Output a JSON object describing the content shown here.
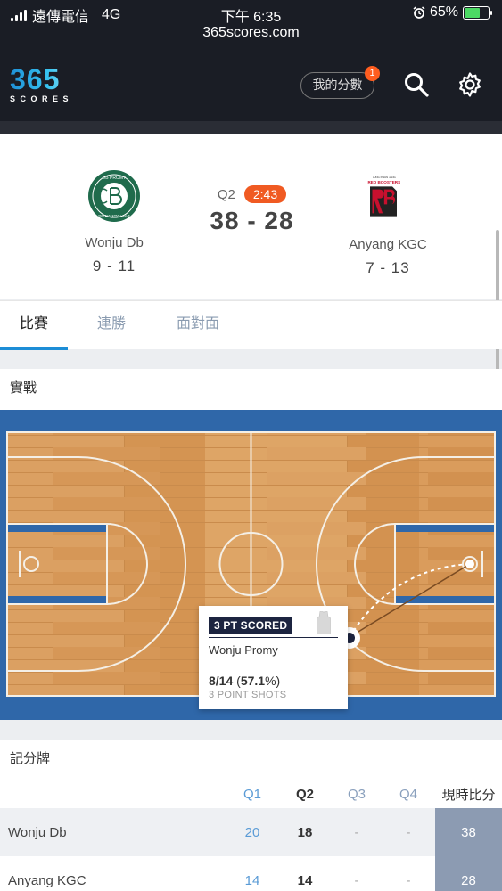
{
  "status_bar": {
    "carrier": "遠傳電信",
    "network": "4G",
    "time": "下午 6:35",
    "url": "365scores.com",
    "battery": "65%",
    "battery_level": 0.65
  },
  "header": {
    "logo_number": "365",
    "logo_text": "SCORES",
    "my_scores_label": "我的分數",
    "notification_count": "1"
  },
  "match": {
    "home": {
      "name": "Wonju Db",
      "record": "9 - 11",
      "logo_text": "DB PROMY",
      "logo_sub": "PRO BASKETBALL CLUB"
    },
    "away": {
      "name": "Anyang KGC",
      "record": "7 - 13",
      "logo_text": "RED BOOSTERS",
      "logo_top": "JUNG KWAN JANG"
    },
    "period": "Q2",
    "clock": "2:43",
    "score": "38 - 28"
  },
  "tabs": [
    {
      "label": "比賽",
      "active": true
    },
    {
      "label": "連勝",
      "active": false
    },
    {
      "label": "面對面",
      "active": false
    }
  ],
  "play": {
    "title": "實戰",
    "event_tag": "3 PT SCORED",
    "player": "Wonju Promy",
    "stat_made": "8/14",
    "stat_pct": "57.1",
    "stat_label": "3 POINT SHOTS"
  },
  "scoreboard": {
    "title": "記分牌",
    "headers": [
      "Q1",
      "Q2",
      "Q3",
      "Q4",
      "現時比分"
    ],
    "rows": [
      {
        "team": "Wonju Db",
        "q1": "20",
        "q2": "18",
        "q3": "-",
        "q4": "-",
        "total": "38"
      },
      {
        "team": "Anyang KGC",
        "q1": "14",
        "q2": "14",
        "q3": "-",
        "q4": "-",
        "total": "28"
      }
    ]
  },
  "colors": {
    "accent": "#1c8dd6",
    "clock_badge": "#f05a22",
    "court_border": "#2f67a9",
    "court_wood": "#d99a58",
    "total_column": "#8c9bb2"
  }
}
